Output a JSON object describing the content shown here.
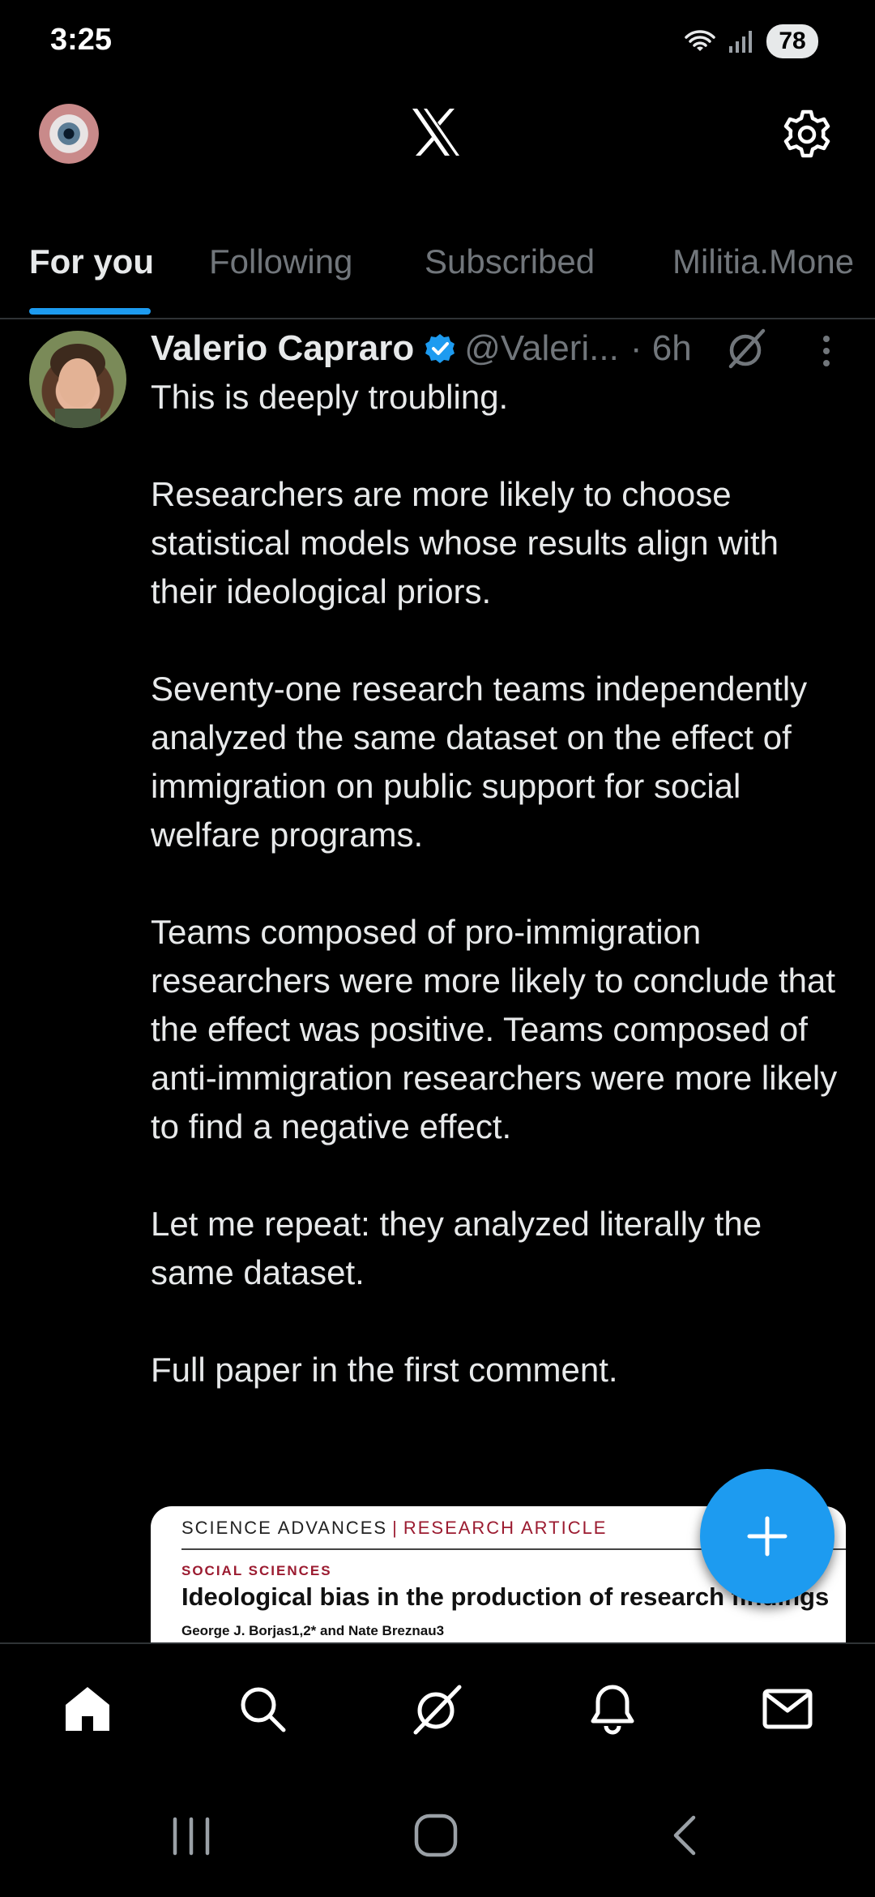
{
  "status_bar": {
    "time": "3:25",
    "battery": "78"
  },
  "tabs": [
    {
      "label": "For you"
    },
    {
      "label": "Following"
    },
    {
      "label": "Subscribed"
    },
    {
      "label": "Militia.Mone"
    }
  ],
  "tweet": {
    "author_name": "Valerio Capraro",
    "handle": "@Valeri...",
    "time": "· 6h",
    "paragraphs": [
      "This is deeply troubling.",
      "Researchers are more likely to choose statistical models whose results align with their ideological priors.",
      "Seventy-one research teams independently analyzed the same dataset on the effect of immigration on public support for social welfare programs.",
      "Teams composed of pro-immigration researchers were more likely to conclude that the effect was positive. Teams composed of anti-immigration researchers were more likely to find a negative effect.",
      "Let me repeat: they analyzed literally the same dataset.",
      "Full paper in the first comment."
    ],
    "card": {
      "journal": "SCIENCE ADVANCES",
      "separator": "|",
      "article_type": "RESEARCH ARTICLE",
      "section": "SOCIAL SCIENCES",
      "title": "Ideological bias in the production of research findings",
      "authors": "George J. Borjas1,2* and Nate Breznau3"
    }
  },
  "colors": {
    "accent": "#1d9bf0",
    "background": "#000000",
    "text": "#e7e9ea",
    "muted": "#71767b"
  },
  "icons": {
    "top_bar": [
      "profile-avatar",
      "x-logo",
      "gear-icon"
    ],
    "bottom_nav": [
      "home-icon",
      "search-icon",
      "grok-icon",
      "bell-icon",
      "mail-icon"
    ],
    "system_nav": [
      "recents-icon",
      "home-circle-icon",
      "back-icon"
    ]
  }
}
